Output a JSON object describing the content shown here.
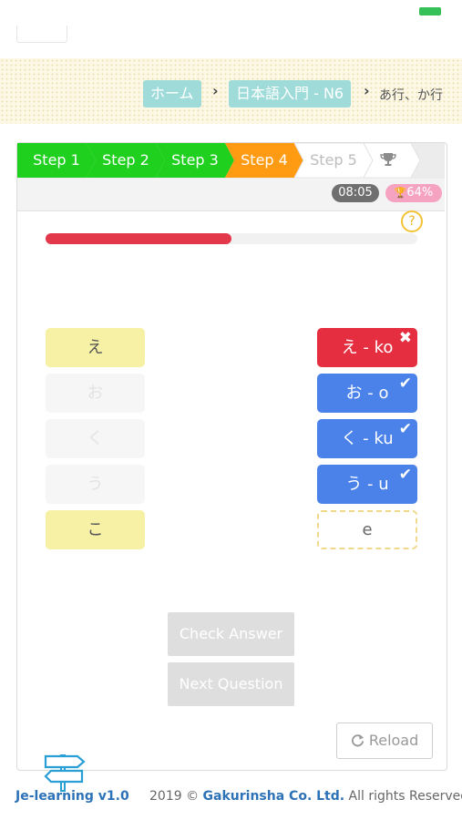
{
  "breadcrumb": {
    "home": "ホーム",
    "course": "日本語入門 - N6",
    "current": "あ行、か行"
  },
  "steps": [
    "Step 1",
    "Step 2",
    "Step 3",
    "Step 4",
    "Step 5"
  ],
  "step_colors": {
    "done": "#1fd01f",
    "active": "#ff9b12",
    "pending": "#bdbdbd"
  },
  "timer": "08:05",
  "score": "64%",
  "help_label": "?",
  "progress_fraction": 0.5,
  "left_tiles": [
    "え",
    "お",
    "く",
    "う",
    "こ"
  ],
  "answers": [
    {
      "text": "え - ko",
      "status": "wrong",
      "mark": "✖"
    },
    {
      "text": "お - o",
      "status": "correct",
      "mark": "✔"
    },
    {
      "text": "く - ku",
      "status": "correct",
      "mark": "✔"
    },
    {
      "text": "う - u",
      "status": "correct",
      "mark": "✔"
    },
    {
      "text": "e",
      "status": "pending",
      "mark": ""
    }
  ],
  "buttons": {
    "check": "Check Answer",
    "next": "Next Question",
    "reload": "Reload"
  },
  "footer": {
    "brand": "Je-learning v1.0",
    "year": "2019 ©",
    "company": "Gakurinsha Co. Ltd.",
    "rights": "All rights Reserved."
  },
  "icons": {
    "trophy": "trophy-icon",
    "reload": "refresh-icon",
    "help": "question-icon",
    "logo": "signpost-icon"
  }
}
